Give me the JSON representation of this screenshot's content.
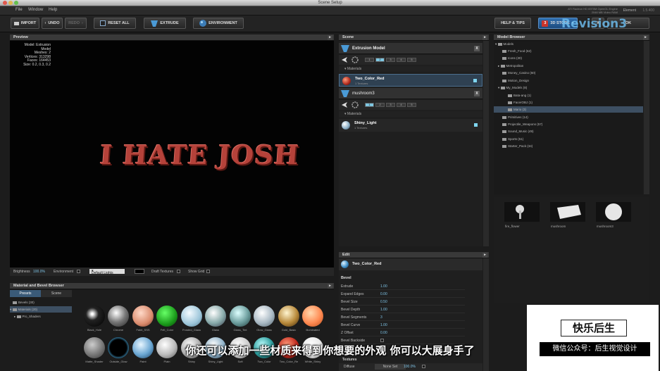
{
  "window": {
    "title": "Scene Setup"
  },
  "menu": [
    "File",
    "Window",
    "Help"
  ],
  "gpu_info": [
    "ATI Radeon HD 6970M OpenGL Engine",
    "2048 MB Video RAM"
  ],
  "app_name": "Element",
  "version": "1.5.400",
  "toolbar": {
    "import": "IMPORT",
    "undo": "UNDO",
    "redo": "REDO",
    "reset_all": "RESET ALL",
    "extrude": "EXTRUDE",
    "environment": "ENVIRONMENT",
    "help_tips": "HELP & TIPS",
    "store_badge": "3",
    "store": "3D STORE",
    "cancel": "X",
    "ok": "OK"
  },
  "preview": {
    "title": "Preview",
    "stats": [
      [
        "Model:",
        "Extrusion Model"
      ],
      [
        "Meshes:",
        "2"
      ],
      [
        "Vertices:",
        "313298"
      ],
      [
        "Faces:",
        "164453"
      ],
      [
        "Size:",
        "0.2, 0.3, 0.2"
      ]
    ],
    "logo_text": "I HATE JOSH",
    "brightness_label": "Brightness",
    "brightness_value": "100.0%",
    "environment_label": "Environment",
    "lights_value": "Default Lights",
    "draft_label": "Draft Textures",
    "grid_label": "Show Grid"
  },
  "scene": {
    "title": "Scene",
    "models": [
      {
        "name": "Extrusion Model",
        "groups": [
          "1",
          "2",
          "3",
          "4",
          "5"
        ],
        "active": 1,
        "materials": [
          {
            "name": "Two_Color_Red",
            "tex": "1 Textures"
          }
        ]
      },
      {
        "name": "mushroom3",
        "groups": [
          "1",
          "2",
          "3",
          "4",
          "5"
        ],
        "active": 0,
        "materials": [
          {
            "name": "Shiny_Light",
            "tex": "1 Textures"
          }
        ]
      }
    ],
    "materials_label": "Materials"
  },
  "model_browser": {
    "title": "Model Browser",
    "tree": [
      "Models",
      "Fresh_Food (62)",
      "Icons (30)",
      "Metropolitan",
      "Money_Casino (60)",
      "Motion_Design",
      "My_Models (8)",
      "Bata-ang (1)",
      "FacerOBJ (1)",
      "Mario (3)",
      "Primitives (14)",
      "Projectile_Weapons (57)",
      "Sound_Music (49)",
      "Sports (51)",
      "Starter_Pack (34)"
    ],
    "thumbs": [
      "fire_flower",
      "mushroom",
      "mushroom3"
    ]
  },
  "edit": {
    "title": "Edit",
    "material": "Two_Color_Red",
    "section": "Bevel",
    "rows": [
      [
        "Extrude",
        "1.00"
      ],
      [
        "Expand Edges",
        "0.00"
      ],
      [
        "Bevel Size",
        "0.50"
      ],
      [
        "Bevel Depth",
        "1.00"
      ],
      [
        "Bevel Segments",
        "3"
      ],
      [
        "Bevel Curve",
        "1.00"
      ],
      [
        "Z Offset",
        "0.00"
      ],
      [
        "Bevel Backside",
        ""
      ]
    ],
    "textures_label": "Textures",
    "diffuse_label": "Diffuse",
    "diffuse_set": "None Set",
    "diffuse_pct": "100.0%"
  },
  "material_browser": {
    "title": "Material and Bevel Browser",
    "tabs": [
      "Presets",
      "Scene"
    ],
    "tree": [
      "Bevels (30)",
      "Materials (20)",
      "Pro_Shaders"
    ],
    "row1": [
      "Black_Hole",
      "Chrome",
      "Faint_SSS",
      "Felt_Color",
      "Frosted_Glass",
      "Glass",
      "Glass_Tint",
      "Glow_Glass",
      "Gold_Basic",
      "Illuminated"
    ],
    "row2": [
      "Matte_Shader",
      "Outside_Glow",
      "Paint",
      "Plain",
      "Shiny",
      "Shiny_Light",
      "Soft",
      "Two_Color",
      "Two_Color_Re",
      "White_Shiny"
    ]
  },
  "watermark": {
    "brand": "Revision3",
    "name": "快乐后生",
    "account": "微信公众号：后生视觉设计"
  },
  "subtitle": "你还可以添加一些材质来得到你想要的外观 你可以大展身手了"
}
